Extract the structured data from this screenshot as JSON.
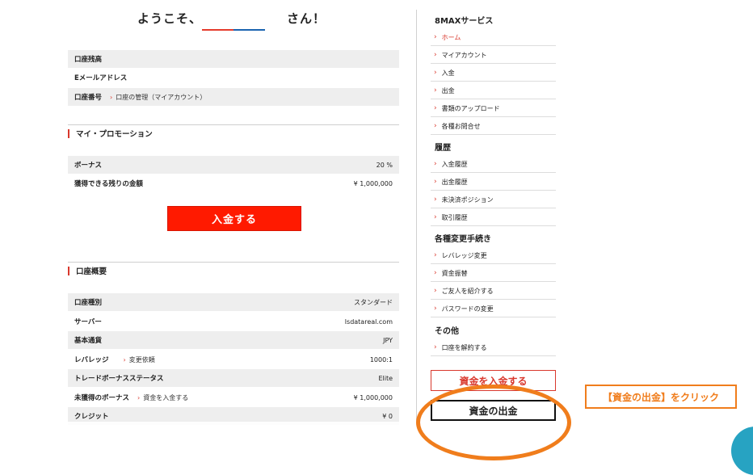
{
  "header": {
    "welcome_prefix": "ようこそ、",
    "welcome_suffix": "さん！"
  },
  "account_info": [
    {
      "label": "口座残高",
      "link": "",
      "value": ""
    },
    {
      "label": "Eメールアドレス",
      "link": "",
      "value": ""
    },
    {
      "label": "口座番号",
      "link": "口座の管理（マイアカウント）",
      "value": ""
    }
  ],
  "promotion": {
    "title": "マイ・プロモーション",
    "rows": [
      {
        "label": "ボーナス",
        "value": "20 %"
      },
      {
        "label": "獲得できる残りの金額",
        "value": "¥ 1,000,000"
      }
    ],
    "deposit_button": "入金する"
  },
  "overview": {
    "title": "口座概要",
    "rows": [
      {
        "label": "口座種別",
        "link": "",
        "value": "スタンダード"
      },
      {
        "label": "サーバー",
        "link": "",
        "value": "lsdatareal.com"
      },
      {
        "label": "基本通貨",
        "link": "",
        "value": "JPY"
      },
      {
        "label": "レバレッジ",
        "link": "変更依頼",
        "value": "1000:1"
      },
      {
        "label": "トレードボーナスステータス",
        "link": "",
        "value": "Elite"
      },
      {
        "label": "未獲得のボーナス",
        "link": "資金を入金する",
        "value": "¥ 1,000,000"
      },
      {
        "label": "クレジット",
        "link": "",
        "value": "¥ 0"
      }
    ]
  },
  "sidebar": {
    "service_title": "8MAXサービス",
    "service_items": [
      "ホーム",
      "マイアカウント",
      "入金",
      "出金",
      "書類のアップロード",
      "各種お問合せ"
    ],
    "history_title": "履歴",
    "history_items": [
      "入金履歴",
      "出金履歴",
      "未決済ポジション",
      "取引履歴"
    ],
    "changes_title": "各種変更手続き",
    "changes_items": [
      "レバレッジ変更",
      "資金振替",
      "ご友人を紹介する",
      "パスワードの変更"
    ],
    "other_title": "その他",
    "other_items": [
      "口座を解約する"
    ],
    "deposit_funds_button": "資金を入金する",
    "withdraw_funds_button": "資金の出金"
  },
  "annotation": {
    "callout": "【資金の出金】をクリック"
  },
  "colors": {
    "accent": "#d9382d",
    "deposit_button": "#ff1a00",
    "annotation": "#f07d1c",
    "teal": "#27a3c2"
  }
}
